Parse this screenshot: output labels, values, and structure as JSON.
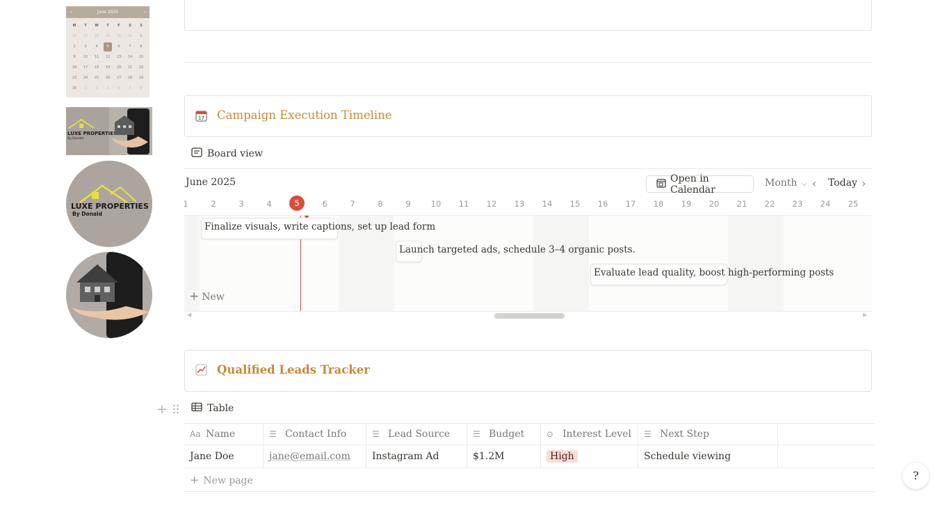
{
  "left_images": {
    "mini_calendar": {
      "month": "June 2025",
      "prev": "‹",
      "next": "›",
      "weekdays": [
        "M",
        "T",
        "W",
        "T",
        "F",
        "S",
        "S"
      ],
      "weeks": [
        [
          "26",
          "27",
          "28",
          "29",
          "30",
          "31",
          "1"
        ],
        [
          "2",
          "3",
          "4",
          "5",
          "6",
          "7",
          "8"
        ],
        [
          "9",
          "10",
          "11",
          "12",
          "13",
          "14",
          "15"
        ],
        [
          "16",
          "17",
          "18",
          "19",
          "20",
          "21",
          "22"
        ],
        [
          "23",
          "24",
          "25",
          "26",
          "27",
          "28",
          "29"
        ],
        [
          "30",
          "1",
          "2",
          "3",
          "4",
          "5",
          "6"
        ]
      ],
      "today": "5"
    },
    "logo_text_line1": "LUXE PROPERTIES",
    "logo_text_line2": "By Donald"
  },
  "timeline_section": {
    "icon": "calendar-17-icon",
    "title": "Campaign Execution Timeline",
    "view_label": "Board view",
    "month_label": "June 2025",
    "open_calendar_label": "Open in Calendar",
    "scale_label": "Month",
    "today_label": "Today",
    "days": [
      "1",
      "2",
      "3",
      "4",
      "5",
      "6",
      "7",
      "8",
      "9",
      "10",
      "11",
      "12",
      "13",
      "14",
      "15",
      "16",
      "17",
      "18",
      "19",
      "20",
      "21",
      "22",
      "23",
      "24",
      "25"
    ],
    "today_day": "5",
    "tasks": [
      {
        "label": "Finalize visuals, write captions, set up lead form"
      },
      {
        "label": "Launch targeted ads, schedule 3–4 organic posts."
      },
      {
        "label": "Evaluate lead quality, boost high-performing posts"
      }
    ],
    "new_label": "New"
  },
  "leads_section": {
    "icon": "chart-increasing-icon",
    "title": "Qualified Leads Tracker",
    "view_label": "Table",
    "columns": [
      {
        "label": "Name",
        "icon": "text-aa-icon"
      },
      {
        "label": "Contact Info",
        "icon": "lines-icon"
      },
      {
        "label": "Lead Source",
        "icon": "lines-icon"
      },
      {
        "label": "Budget",
        "icon": "lines-icon"
      },
      {
        "label": "Interest Level",
        "icon": "select-icon"
      },
      {
        "label": "Next Step",
        "icon": "lines-icon"
      }
    ],
    "rows": [
      {
        "name": "Jane Doe",
        "contact": "jane@email.com",
        "source": "Instagram Ad",
        "budget": "$1.2M",
        "interest": "High",
        "next_step": "Schedule viewing"
      }
    ],
    "new_page_label": "New page"
  },
  "colors": {
    "accent_title": "#c7893a",
    "today_red": "#d94b3c",
    "tag_high_bg": "#fbdcd8"
  }
}
